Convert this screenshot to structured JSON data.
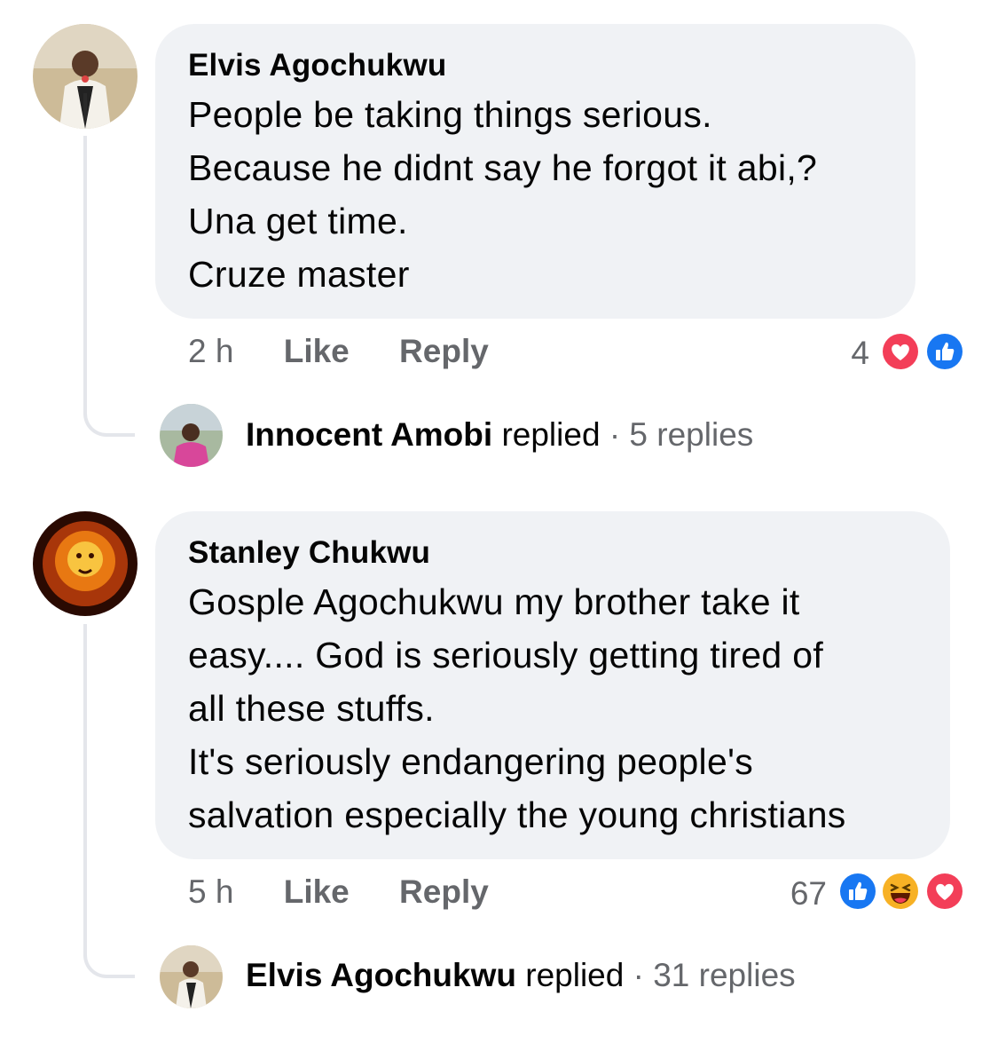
{
  "comments": [
    {
      "author": "Elvis Agochukwu",
      "lines": [
        "People be taking things serious.",
        "Because he didnt say he forgot it abi,?",
        "Una get time.",
        "Cruze master"
      ],
      "time": "2 h",
      "like_label": "Like",
      "reply_label": "Reply",
      "reaction_count": "4",
      "reactions": [
        "love-icon",
        "like-icon"
      ],
      "reply_summary": {
        "name": "Innocent Amobi",
        "verb": "replied",
        "separator": "·",
        "count": "5 replies"
      }
    },
    {
      "author": "Stanley Chukwu",
      "lines": [
        "Gosple Agochukwu my brother take it",
        "easy.... God is seriously getting tired of",
        "all these stuffs.",
        "It's seriously endangering people's",
        "salvation especially the young christians"
      ],
      "time": "5 h",
      "like_label": "Like",
      "reply_label": "Reply",
      "reaction_count": "67",
      "reactions": [
        "like-icon",
        "haha-icon",
        "love-icon"
      ],
      "reply_summary": {
        "name": "Elvis Agochukwu",
        "verb": "replied",
        "separator": "·",
        "count": "31 replies"
      }
    }
  ],
  "colors": {
    "bubble": "#f0f2f5",
    "meta_text": "#65676b",
    "like_blue": "#1877f2",
    "love_red": "#f33e58",
    "haha_yellow": "#f7b125",
    "thread_line": "#e4e6eb"
  }
}
